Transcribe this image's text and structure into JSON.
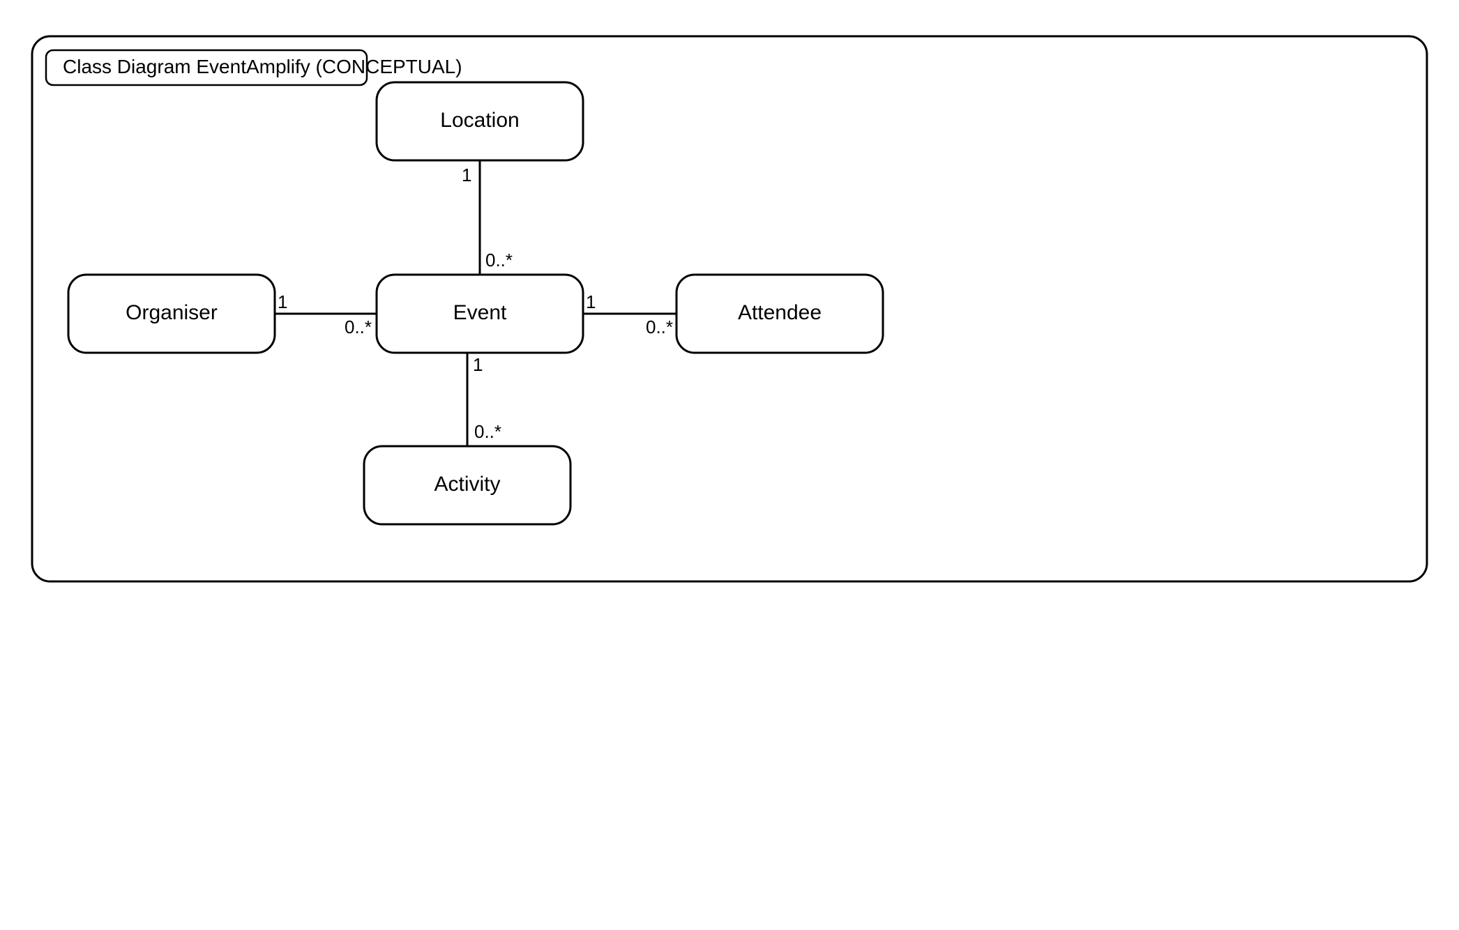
{
  "diagram": {
    "title": "Class Diagram EventAmplify (CONCEPTUAL)",
    "nodes": {
      "location": "Location",
      "event": "Event",
      "organiser": "Organiser",
      "attendee": "Attendee",
      "activity": "Activity"
    },
    "edges": {
      "location_event": {
        "location_side": "1",
        "event_side": "0..*"
      },
      "organiser_event": {
        "organiser_side": "1",
        "event_side": "0..*"
      },
      "event_attendee": {
        "event_side": "1",
        "attendee_side": "0..*"
      },
      "event_activity": {
        "event_side": "1",
        "activity_side": "0..*"
      }
    }
  }
}
